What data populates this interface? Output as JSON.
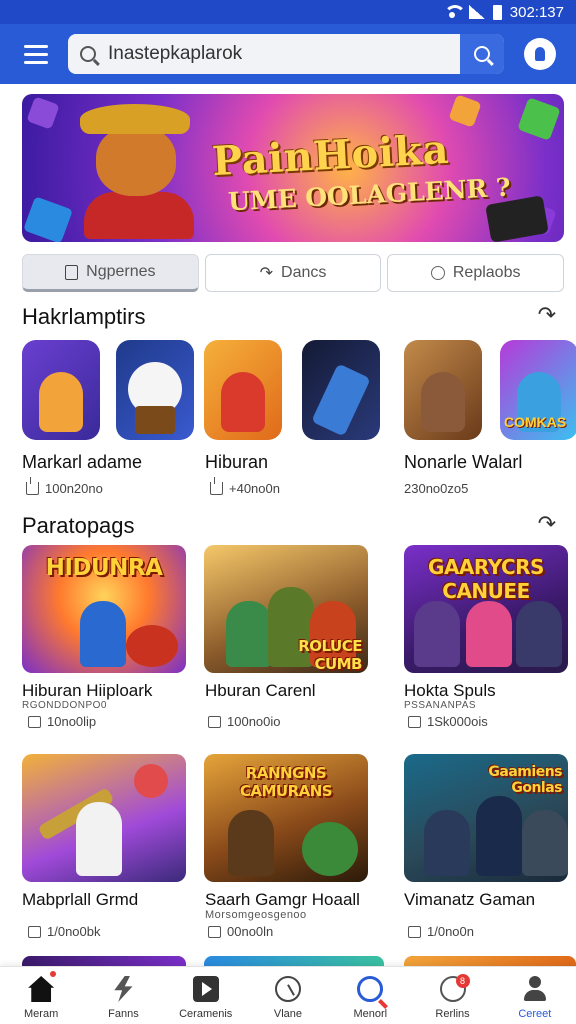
{
  "status_bar": {
    "time": "302:137"
  },
  "search": {
    "value": "Inastepkaplarok"
  },
  "banner": {
    "title": "PainHoika",
    "subtitle": "UME OOLAGLENR ?"
  },
  "tabs": [
    {
      "label": "Ngpernes",
      "active": true
    },
    {
      "label": "Dancs",
      "active": false
    },
    {
      "label": "Replaobs",
      "active": false
    }
  ],
  "section1": {
    "title": "Hakrlamptirs",
    "more": "↷",
    "apps": [
      {
        "name": "Markarl adame",
        "meta": "100n20no",
        "colors": [
          "#6a3fd0",
          "#f2a33a"
        ]
      },
      {
        "name": "",
        "meta": "",
        "colors": [
          "#1f3a8a",
          "#f5f5f5"
        ]
      },
      {
        "name": "Hiburan",
        "meta": "+40no0n",
        "colors": [
          "#f59a1b",
          "#d93a2b"
        ]
      },
      {
        "name": "",
        "meta": "",
        "colors": [
          "#1b1f3a",
          "#3a7bd5"
        ]
      },
      {
        "name": "Nonarle Walarl",
        "meta": "230no0zo5",
        "colors": [
          "#7a4a2a",
          "#c28a4a"
        ]
      },
      {
        "name": "",
        "meta": "",
        "colors": [
          "#b63ad9",
          "#3ac1f0"
        ],
        "art": "COMKAS"
      }
    ]
  },
  "section2": {
    "title": "Paratopags",
    "more": "↷",
    "games": [
      {
        "name": "Hiburan Hiiploark",
        "sub": "RGONDDONPO0",
        "meta": "10no0lip",
        "art": "HIDUNRA",
        "colors": [
          "#ff9d2e",
          "#7a2fc9"
        ]
      },
      {
        "name": "Hburan Carenl",
        "sub": "",
        "meta": "100no0io",
        "art": "ROLUCE CUMB",
        "colors": [
          "#3a8a4a",
          "#f5b342"
        ]
      },
      {
        "name": "Hokta Spuls",
        "sub": "PSSANANPAS",
        "meta": "1Sk000ois",
        "art": "GAARYCRS CANUEE",
        "colors": [
          "#7a2fc9",
          "#e14b8a"
        ]
      },
      {
        "name": "Mabprlall Grmd",
        "sub": "",
        "meta": "1/0no0bk",
        "art": "",
        "colors": [
          "#f2b13a",
          "#6a3fd0"
        ]
      },
      {
        "name": "Saarh Gamgr Hoaall",
        "sub": "Morsomgeosgenoo",
        "meta": "00no0ln",
        "art": "RANNGNS CAMURANS",
        "colors": [
          "#6a3a1a",
          "#e6a43a"
        ]
      },
      {
        "name": "Vimanatz Gaman",
        "sub": "",
        "meta": "1/0no0n",
        "art": "Gaamiens Gonlas",
        "colors": [
          "#1a6a8a",
          "#3ac1a0"
        ]
      }
    ]
  },
  "bottom_nav": [
    {
      "label": "Meram",
      "icon": "home-icon"
    },
    {
      "label": "Fanns",
      "icon": "bolt-icon"
    },
    {
      "label": "Ceramenis",
      "icon": "play-icon"
    },
    {
      "label": "Vlane",
      "icon": "clock-icon"
    },
    {
      "label": "Menorl",
      "icon": "search-icon"
    },
    {
      "label": "Rerlins",
      "icon": "chat-icon",
      "badge": "8"
    },
    {
      "label": "Cereet",
      "icon": "user-icon",
      "active": true
    }
  ]
}
